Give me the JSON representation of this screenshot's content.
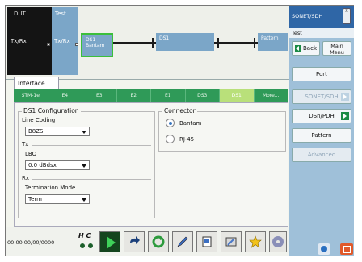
{
  "diagram": {
    "dut_title": "DUT",
    "dut_txrx": "Tx/Rx",
    "test_title": "Test",
    "test_txrx": "Tx/Rx",
    "seg_ds1_bantam_line1": "DS1",
    "seg_ds1_bantam_line2": "Bantam",
    "seg_ds1": "DS1",
    "seg_pattern": "Pattern"
  },
  "interface_tab": "Interface",
  "subtabs": [
    "STM-1e",
    "E4",
    "E3",
    "E2",
    "E1",
    "DS3",
    "DS1",
    "More..."
  ],
  "active_subtab": "DS1",
  "ds1_config": {
    "title": "DS1 Configuration",
    "line_coding_label": "Line Coding",
    "line_coding_value": "B8ZS",
    "tx_title": "Tx",
    "lbo_label": "LBO",
    "lbo_value": "0.0 dBdsx",
    "rx_title": "Rx",
    "termination_label": "Termination Mode",
    "termination_value": "Term"
  },
  "connector": {
    "title": "Connector",
    "options": [
      "Bantam",
      "RJ-45"
    ],
    "selected": "Bantam"
  },
  "sidebar": {
    "header": "SONET/SDH",
    "close_label": "X",
    "subheader": "Test",
    "back_label": "Back",
    "main_menu_line1": "Main",
    "main_menu_line2": "Menu",
    "buttons": [
      {
        "label": "Port",
        "enabled": true,
        "has_arrow": false
      },
      {
        "label": "SONET/SDH",
        "enabled": false,
        "has_arrow": true
      },
      {
        "label": "DSn/PDH",
        "enabled": true,
        "has_arrow": true
      },
      {
        "label": "Pattern",
        "enabled": true,
        "has_arrow": false
      },
      {
        "label": "Advanced",
        "enabled": false,
        "has_arrow": false
      }
    ]
  },
  "bottombar": {
    "datetime": "00:00 00/00/0000",
    "hc_label": "H C",
    "toolbar_icons": [
      "play-icon",
      "undo-icon",
      "refresh-icon",
      "pen-icon",
      "report-icon",
      "tools-icon",
      "favorite-star-icon",
      "disc-icon"
    ]
  },
  "colors": {
    "diagram_box": "#7ba6c8",
    "tab_green": "#2f9a58",
    "active_tab": "#b9e07a",
    "sidebar_header": "#2f66a6",
    "sidebar_bg": "#9fc0d9",
    "arrow_green": "#1b8a44"
  }
}
